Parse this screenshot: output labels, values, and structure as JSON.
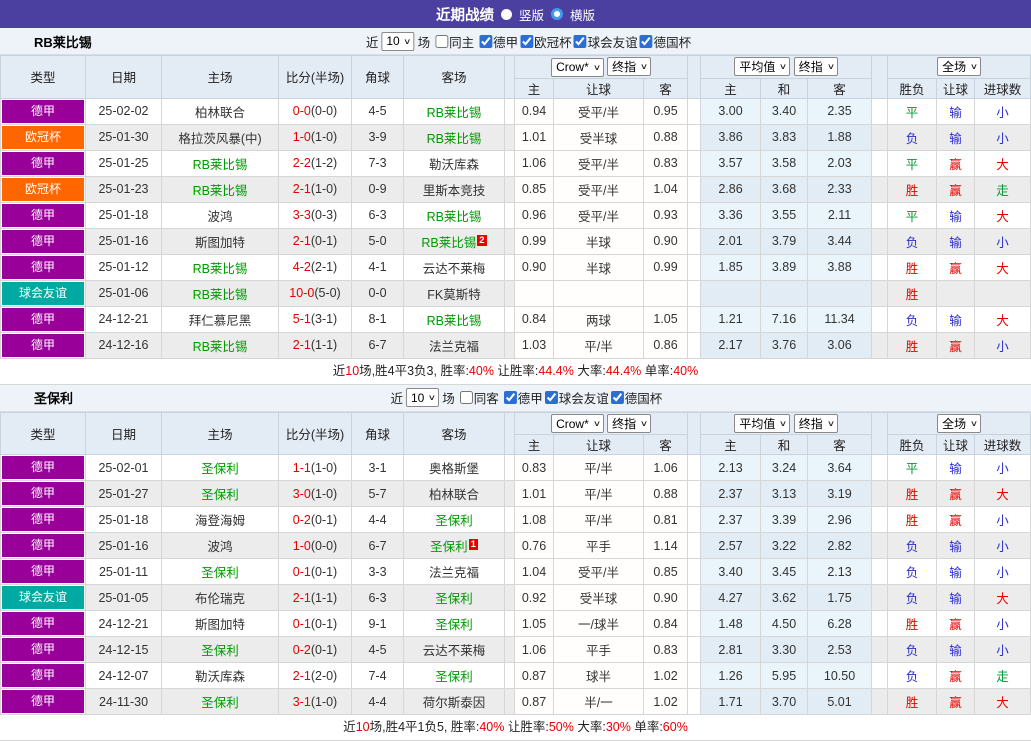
{
  "title_bar": {
    "title": "近期战绩",
    "radios": [
      {
        "label": "竖版",
        "selected": false
      },
      {
        "label": "横版",
        "selected": true
      }
    ]
  },
  "colors": {
    "title_bar_bg": "#4b3fa0",
    "team_green": "#009900",
    "score_red": "#e60000",
    "avg_col_bg": "#e9f5fb"
  },
  "league_colors": {
    "德甲": "#990099",
    "欧冠杯": "#ff6600",
    "球会友谊": "#00aaa2"
  },
  "result_colors": {
    "胜": "#e60000",
    "赢": "#e60000",
    "大": "#e60000",
    "平": "#009933",
    "走": "#009933",
    "负": "#2d2dd0",
    "输": "#2d2dd0",
    "小": "#2d2dd0"
  },
  "columns": {
    "type": "类型",
    "date": "日期",
    "home": "主场",
    "score": "比分(半场)",
    "corner": "角球",
    "away": "客场",
    "crow_select": "Crow*",
    "final_select": "终指",
    "avg_select": "平均值",
    "final_select2": "终指",
    "full_select": "全场",
    "crow_sub": [
      "主",
      "让球",
      "客"
    ],
    "avg_sub": [
      "主",
      "和",
      "客"
    ],
    "full_sub": [
      "胜负",
      "让球",
      "进球数"
    ]
  },
  "sections": [
    {
      "team": "RB莱比锡",
      "filter": {
        "near_label": "近",
        "count": "10",
        "games_label": "场",
        "same_label": "同主",
        "same_checked": false,
        "leagues": [
          {
            "label": "德甲",
            "checked": true
          },
          {
            "label": "欧冠杯",
            "checked": true
          },
          {
            "label": "球会友谊",
            "checked": true
          },
          {
            "label": "德国杯",
            "checked": true
          }
        ]
      },
      "rows": [
        {
          "league": "德甲",
          "date": "25-02-02",
          "home": "柏林联合",
          "home_self": false,
          "score": "0-0",
          "half": "(0-0)",
          "corner": "4-5",
          "away": "RB莱比锡",
          "away_self": true,
          "badge": "",
          "crow": [
            "0.94",
            "受平/半",
            "0.95"
          ],
          "avg": [
            "3.00",
            "3.40",
            "2.35"
          ],
          "res": [
            "平",
            "输",
            "小"
          ]
        },
        {
          "league": "欧冠杯",
          "date": "25-01-30",
          "home": "格拉茨风暴(中)",
          "home_self": false,
          "score": "1-0",
          "half": "(1-0)",
          "corner": "3-9",
          "away": "RB莱比锡",
          "away_self": true,
          "badge": "",
          "crow": [
            "1.01",
            "受半球",
            "0.88"
          ],
          "avg": [
            "3.86",
            "3.83",
            "1.88"
          ],
          "res": [
            "负",
            "输",
            "小"
          ]
        },
        {
          "league": "德甲",
          "date": "25-01-25",
          "home": "RB莱比锡",
          "home_self": true,
          "score": "2-2",
          "half": "(1-2)",
          "corner": "7-3",
          "away": "勒沃库森",
          "away_self": false,
          "badge": "",
          "crow": [
            "1.06",
            "受平/半",
            "0.83"
          ],
          "avg": [
            "3.57",
            "3.58",
            "2.03"
          ],
          "res": [
            "平",
            "赢",
            "大"
          ]
        },
        {
          "league": "欧冠杯",
          "date": "25-01-23",
          "home": "RB莱比锡",
          "home_self": true,
          "score": "2-1",
          "half": "(1-0)",
          "corner": "0-9",
          "away": "里斯本竞技",
          "away_self": false,
          "badge": "",
          "crow": [
            "0.85",
            "受平/半",
            "1.04"
          ],
          "avg": [
            "2.86",
            "3.68",
            "2.33"
          ],
          "res": [
            "胜",
            "赢",
            "走"
          ]
        },
        {
          "league": "德甲",
          "date": "25-01-18",
          "home": "波鸿",
          "home_self": false,
          "score": "3-3",
          "half": "(0-3)",
          "corner": "6-3",
          "away": "RB莱比锡",
          "away_self": true,
          "badge": "",
          "crow": [
            "0.96",
            "受平/半",
            "0.93"
          ],
          "avg": [
            "3.36",
            "3.55",
            "2.11"
          ],
          "res": [
            "平",
            "输",
            "大"
          ]
        },
        {
          "league": "德甲",
          "date": "25-01-16",
          "home": "斯图加特",
          "home_self": false,
          "score": "2-1",
          "half": "(0-1)",
          "corner": "5-0",
          "away": "RB莱比锡",
          "away_self": true,
          "badge": "2",
          "crow": [
            "0.99",
            "半球",
            "0.90"
          ],
          "avg": [
            "2.01",
            "3.79",
            "3.44"
          ],
          "res": [
            "负",
            "输",
            "小"
          ]
        },
        {
          "league": "德甲",
          "date": "25-01-12",
          "home": "RB莱比锡",
          "home_self": true,
          "score": "4-2",
          "half": "(2-1)",
          "corner": "4-1",
          "away": "云达不莱梅",
          "away_self": false,
          "badge": "",
          "crow": [
            "0.90",
            "半球",
            "0.99"
          ],
          "avg": [
            "1.85",
            "3.89",
            "3.88"
          ],
          "res": [
            "胜",
            "赢",
            "大"
          ]
        },
        {
          "league": "球会友谊",
          "date": "25-01-06",
          "home": "RB莱比锡",
          "home_self": true,
          "score": "10-0",
          "half": "(5-0)",
          "corner": "0-0",
          "away": "FK莫斯特",
          "away_self": false,
          "badge": "",
          "crow": [
            "",
            "",
            ""
          ],
          "avg": [
            "",
            "",
            ""
          ],
          "res": [
            "胜",
            "",
            ""
          ]
        },
        {
          "league": "德甲",
          "date": "24-12-21",
          "home": "拜仁慕尼黑",
          "home_self": false,
          "score": "5-1",
          "half": "(3-1)",
          "corner": "8-1",
          "away": "RB莱比锡",
          "away_self": true,
          "badge": "",
          "crow": [
            "0.84",
            "两球",
            "1.05"
          ],
          "avg": [
            "1.21",
            "7.16",
            "11.34"
          ],
          "res": [
            "负",
            "输",
            "大"
          ]
        },
        {
          "league": "德甲",
          "date": "24-12-16",
          "home": "RB莱比锡",
          "home_self": true,
          "score": "2-1",
          "half": "(1-1)",
          "corner": "6-7",
          "away": "法兰克福",
          "away_self": false,
          "badge": "",
          "crow": [
            "1.03",
            "平/半",
            "0.86"
          ],
          "avg": [
            "2.17",
            "3.76",
            "3.06"
          ],
          "res": [
            "胜",
            "赢",
            "小"
          ]
        }
      ],
      "summary_parts": [
        {
          "text": "近",
          "red": false
        },
        {
          "text": "10",
          "red": true
        },
        {
          "text": "场,胜4平3负3, 胜率:",
          "red": false
        },
        {
          "text": "40%",
          "red": true
        },
        {
          "text": " 让胜率:",
          "red": false
        },
        {
          "text": "44.4%",
          "red": true
        },
        {
          "text": " 大率:",
          "red": false
        },
        {
          "text": "44.4%",
          "red": true
        },
        {
          "text": " 单率:",
          "red": false
        },
        {
          "text": "40%",
          "red": true
        }
      ]
    },
    {
      "team": "圣保利",
      "filter": {
        "near_label": "近",
        "count": "10",
        "games_label": "场",
        "same_label": "同客",
        "same_checked": false,
        "leagues": [
          {
            "label": "德甲",
            "checked": true
          },
          {
            "label": "球会友谊",
            "checked": true
          },
          {
            "label": "德国杯",
            "checked": true
          }
        ]
      },
      "rows": [
        {
          "league": "德甲",
          "date": "25-02-01",
          "home": "圣保利",
          "home_self": true,
          "score": "1-1",
          "half": "(1-0)",
          "corner": "3-1",
          "away": "奥格斯堡",
          "away_self": false,
          "badge": "",
          "crow": [
            "0.83",
            "平/半",
            "1.06"
          ],
          "avg": [
            "2.13",
            "3.24",
            "3.64"
          ],
          "res": [
            "平",
            "输",
            "小"
          ]
        },
        {
          "league": "德甲",
          "date": "25-01-27",
          "home": "圣保利",
          "home_self": true,
          "score": "3-0",
          "half": "(1-0)",
          "corner": "5-7",
          "away": "柏林联合",
          "away_self": false,
          "badge": "",
          "crow": [
            "1.01",
            "平/半",
            "0.88"
          ],
          "avg": [
            "2.37",
            "3.13",
            "3.19"
          ],
          "res": [
            "胜",
            "赢",
            "大"
          ]
        },
        {
          "league": "德甲",
          "date": "25-01-18",
          "home": "海登海姆",
          "home_self": false,
          "score": "0-2",
          "half": "(0-1)",
          "corner": "4-4",
          "away": "圣保利",
          "away_self": true,
          "badge": "",
          "crow": [
            "1.08",
            "平/半",
            "0.81"
          ],
          "avg": [
            "2.37",
            "3.39",
            "2.96"
          ],
          "res": [
            "胜",
            "赢",
            "小"
          ]
        },
        {
          "league": "德甲",
          "date": "25-01-16",
          "home": "波鸿",
          "home_self": false,
          "score": "1-0",
          "half": "(0-0)",
          "corner": "6-7",
          "away": "圣保利",
          "away_self": true,
          "badge": "1",
          "crow": [
            "0.76",
            "平手",
            "1.14"
          ],
          "avg": [
            "2.57",
            "3.22",
            "2.82"
          ],
          "res": [
            "负",
            "输",
            "小"
          ]
        },
        {
          "league": "德甲",
          "date": "25-01-11",
          "home": "圣保利",
          "home_self": true,
          "score": "0-1",
          "half": "(0-1)",
          "corner": "3-3",
          "away": "法兰克福",
          "away_self": false,
          "badge": "",
          "crow": [
            "1.04",
            "受平/半",
            "0.85"
          ],
          "avg": [
            "3.40",
            "3.45",
            "2.13"
          ],
          "res": [
            "负",
            "输",
            "小"
          ]
        },
        {
          "league": "球会友谊",
          "date": "25-01-05",
          "home": "布伦瑞克",
          "home_self": false,
          "score": "2-1",
          "half": "(1-1)",
          "corner": "6-3",
          "away": "圣保利",
          "away_self": true,
          "badge": "",
          "crow": [
            "0.92",
            "受半球",
            "0.90"
          ],
          "avg": [
            "4.27",
            "3.62",
            "1.75"
          ],
          "res": [
            "负",
            "输",
            "大"
          ]
        },
        {
          "league": "德甲",
          "date": "24-12-21",
          "home": "斯图加特",
          "home_self": false,
          "score": "0-1",
          "half": "(0-1)",
          "corner": "9-1",
          "away": "圣保利",
          "away_self": true,
          "badge": "",
          "crow": [
            "1.05",
            "一/球半",
            "0.84"
          ],
          "avg": [
            "1.48",
            "4.50",
            "6.28"
          ],
          "res": [
            "胜",
            "赢",
            "小"
          ]
        },
        {
          "league": "德甲",
          "date": "24-12-15",
          "home": "圣保利",
          "home_self": true,
          "score": "0-2",
          "half": "(0-1)",
          "corner": "4-5",
          "away": "云达不莱梅",
          "away_self": false,
          "badge": "",
          "crow": [
            "1.06",
            "平手",
            "0.83"
          ],
          "avg": [
            "2.81",
            "3.30",
            "2.53"
          ],
          "res": [
            "负",
            "输",
            "小"
          ]
        },
        {
          "league": "德甲",
          "date": "24-12-07",
          "home": "勒沃库森",
          "home_self": false,
          "score": "2-1",
          "half": "(2-0)",
          "corner": "7-4",
          "away": "圣保利",
          "away_self": true,
          "badge": "",
          "crow": [
            "0.87",
            "球半",
            "1.02"
          ],
          "avg": [
            "1.26",
            "5.95",
            "10.50"
          ],
          "res": [
            "负",
            "赢",
            "走"
          ]
        },
        {
          "league": "德甲",
          "date": "24-11-30",
          "home": "圣保利",
          "home_self": true,
          "score": "3-1",
          "half": "(1-0)",
          "corner": "4-4",
          "away": "荷尔斯泰因",
          "away_self": false,
          "badge": "",
          "crow": [
            "0.87",
            "半/一",
            "1.02"
          ],
          "avg": [
            "1.71",
            "3.70",
            "5.01"
          ],
          "res": [
            "胜",
            "赢",
            "大"
          ]
        }
      ],
      "summary_parts": [
        {
          "text": "近",
          "red": false
        },
        {
          "text": "10",
          "red": true
        },
        {
          "text": "场,胜4平1负5, 胜率:",
          "red": false
        },
        {
          "text": "40%",
          "red": true
        },
        {
          "text": " 让胜率:",
          "red": false
        },
        {
          "text": "50%",
          "red": true
        },
        {
          "text": " 大率:",
          "red": false
        },
        {
          "text": "30%",
          "red": true
        },
        {
          "text": " 单率:",
          "red": false
        },
        {
          "text": "60%",
          "red": true
        }
      ]
    }
  ]
}
